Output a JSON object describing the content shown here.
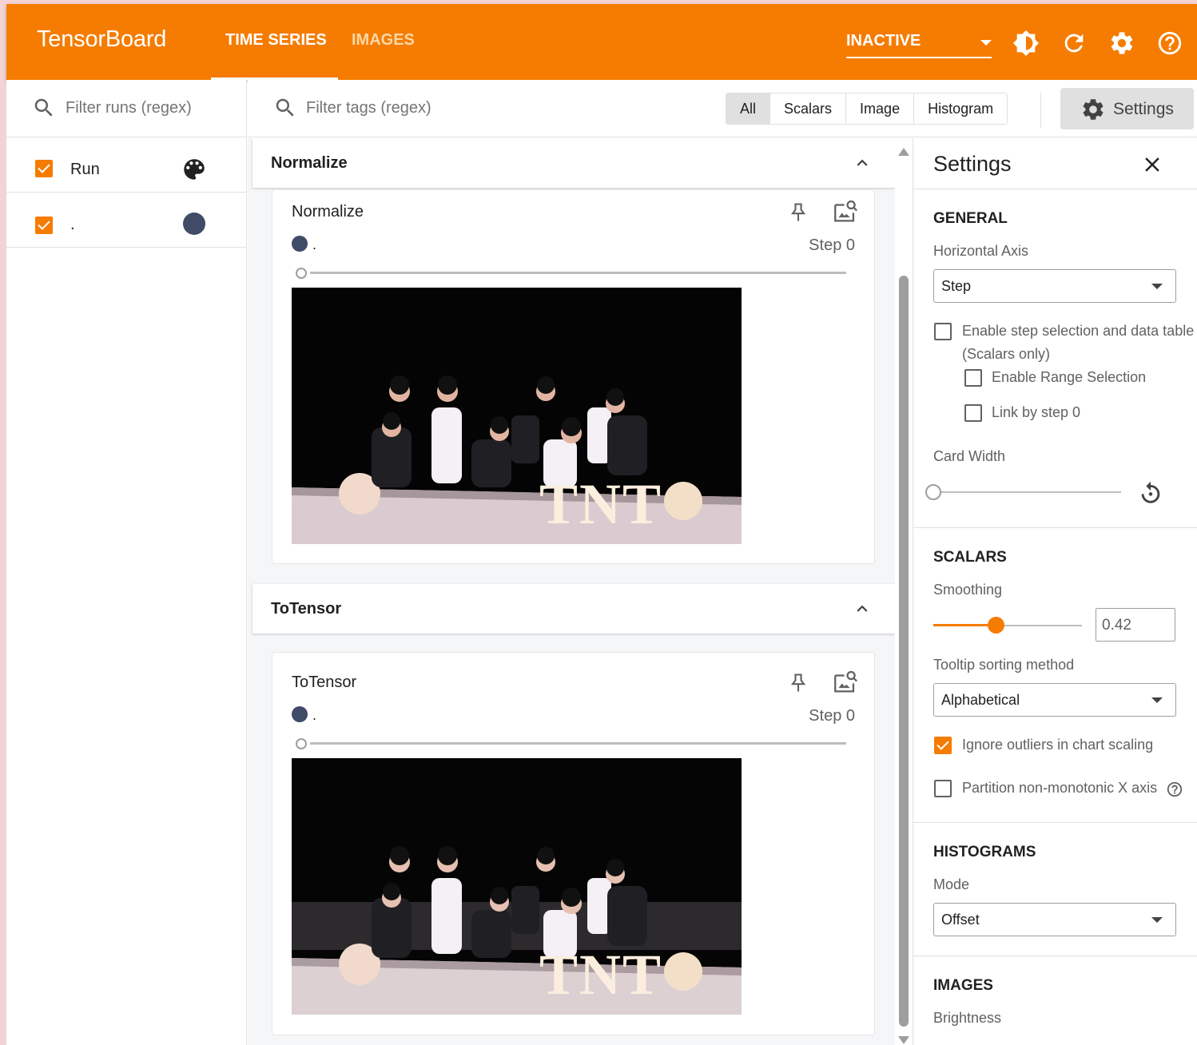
{
  "header": {
    "brand": "TensorBoard",
    "tabs": [
      {
        "label": "TIME SERIES",
        "active": true
      },
      {
        "label": "IMAGES",
        "active": false
      }
    ],
    "status_select": "INACTIVE",
    "icons": [
      "brightness-icon",
      "refresh-icon",
      "settings-gear-icon",
      "help-icon"
    ],
    "accent_color": "#f57c00"
  },
  "runs": {
    "filter_placeholder": "Filter runs (regex)",
    "header_row": {
      "label": "Run",
      "checked": true,
      "icon": "palette-icon"
    },
    "items": [
      {
        "label": ".",
        "checked": true,
        "color": "#3f4b67"
      }
    ]
  },
  "toolbar": {
    "filter_placeholder": "Filter tags (regex)",
    "type_filters": [
      "All",
      "Scalars",
      "Image",
      "Histogram"
    ],
    "selected_type": "All",
    "settings_label": "Settings"
  },
  "groups": [
    {
      "title": "Normalize",
      "card": {
        "title": "Normalize",
        "run_label": ".",
        "step_label": "Step 0",
        "image": "group-photo"
      }
    },
    {
      "title": "ToTensor",
      "card": {
        "title": "ToTensor",
        "run_label": ".",
        "step_label": "Step 0",
        "image": "group-photo"
      }
    }
  ],
  "settings": {
    "title": "Settings",
    "general": {
      "heading": "GENERAL",
      "horizontal_axis_label": "Horizontal Axis",
      "horizontal_axis_value": "Step",
      "enable_step_selection": {
        "label_line1": "Enable step selection and data table",
        "label_line2": "(Scalars only)",
        "checked": false
      },
      "enable_range_selection": {
        "label": "Enable Range Selection",
        "checked": false
      },
      "link_by_step": {
        "label": "Link by step 0",
        "checked": false
      },
      "card_width_label": "Card Width"
    },
    "scalars": {
      "heading": "SCALARS",
      "smoothing_label": "Smoothing",
      "smoothing_value": "0.42",
      "tooltip_sort_label": "Tooltip sorting method",
      "tooltip_sort_value": "Alphabetical",
      "ignore_outliers": {
        "label": "Ignore outliers in chart scaling",
        "checked": true
      },
      "partition_x": {
        "label": "Partition non-monotonic X axis",
        "checked": false
      }
    },
    "histograms": {
      "heading": "HISTOGRAMS",
      "mode_label": "Mode",
      "mode_value": "Offset"
    },
    "images": {
      "heading": "IMAGES",
      "brightness_label": "Brightness"
    }
  }
}
